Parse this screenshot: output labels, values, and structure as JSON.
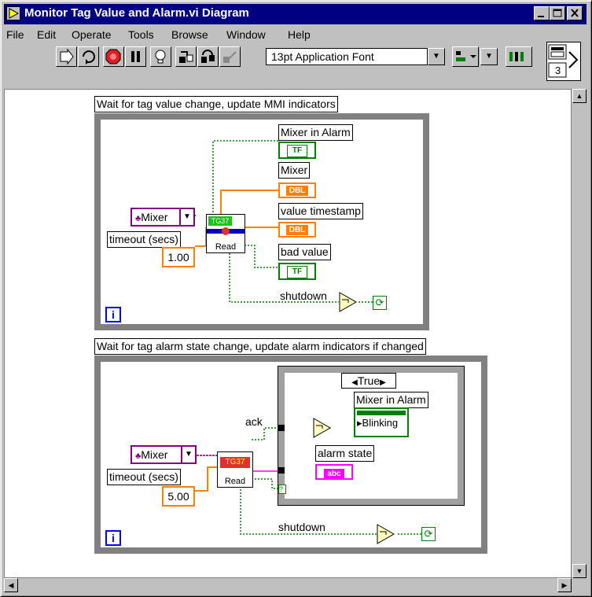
{
  "window": {
    "title": "Monitor Tag Value and Alarm.vi Diagram"
  },
  "menu": {
    "items": [
      "File",
      "Edit",
      "Operate",
      "Tools",
      "Browse",
      "Window",
      "Help"
    ]
  },
  "toolbar": {
    "font": "13pt Application Font"
  },
  "connector": {
    "number": "3"
  },
  "loop1": {
    "title": "Wait for tag value change, update MMI indicators",
    "tag_control": "Mixer",
    "timeout_label": "timeout (secs)",
    "timeout_value": "1.00",
    "read_label": "Read",
    "ind_alarm": "Mixer in Alarm",
    "ind_mixer": "Mixer",
    "ind_timestamp": "value timestamp",
    "ind_bad": "bad value",
    "shutdown": "shutdown",
    "tf": "TF",
    "dbl": "DBL",
    "tg": "TG37",
    "iter": "i"
  },
  "loop2": {
    "title": "Wait for tag alarm state change, update alarm indicators if changed",
    "tag_control": "Mixer",
    "timeout_label": "timeout (secs)",
    "timeout_value": "5.00",
    "read_label": "Read",
    "ack": "ack",
    "case_selector": "True",
    "ind_alarm": "Mixer in Alarm",
    "blinking": "Blinking",
    "ind_state": "alarm state",
    "abc": "abc",
    "shutdown": "shutdown",
    "tg": "TG37",
    "iter": "i"
  }
}
